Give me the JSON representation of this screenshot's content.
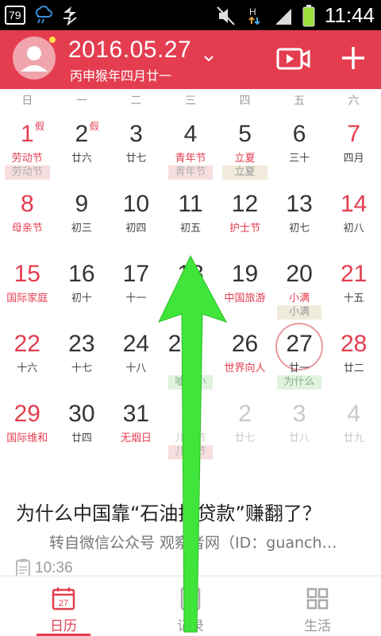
{
  "status_bar": {
    "badge": "79",
    "time": "11:44",
    "icons": [
      "cloud-rain-icon",
      "sync-icon",
      "mute-icon",
      "data-icon",
      "signal-icon",
      "battery-icon"
    ]
  },
  "header": {
    "date": "2016.05.27",
    "lunar": "丙申猴年四月廿一",
    "icons": [
      "avatar-icon",
      "chevron-down-icon",
      "video-icon",
      "plus-icon"
    ],
    "color": "#e43d50"
  },
  "weekdays": [
    "日",
    "一",
    "二",
    "三",
    "四",
    "五",
    "六"
  ],
  "weeks": [
    [
      {
        "day": "1",
        "sub": "劳动节",
        "tag": "劳动节",
        "badge": "假"
      },
      {
        "day": "2",
        "sub": "廿六",
        "badge": "假"
      },
      {
        "day": "3",
        "sub": "廿七"
      },
      {
        "day": "4",
        "sub": "青年节",
        "tag": "青年节"
      },
      {
        "day": "5",
        "sub": "立夏",
        "tag": "立夏"
      },
      {
        "day": "6",
        "sub": "三十"
      },
      {
        "day": "7",
        "sub": "四月"
      }
    ],
    [
      {
        "day": "8",
        "sub": "母亲节"
      },
      {
        "day": "9",
        "sub": "初三"
      },
      {
        "day": "10",
        "sub": "初四"
      },
      {
        "day": "11",
        "sub": "初五"
      },
      {
        "day": "12",
        "sub": "护士节"
      },
      {
        "day": "13",
        "sub": "初七"
      },
      {
        "day": "14",
        "sub": "初八"
      }
    ],
    [
      {
        "day": "15",
        "sub": "国际家庭"
      },
      {
        "day": "16",
        "sub": "初十"
      },
      {
        "day": "17",
        "sub": "十一"
      },
      {
        "day": "18",
        "sub": ""
      },
      {
        "day": "19",
        "sub": "中国旅游"
      },
      {
        "day": "20",
        "sub": "小满",
        "tag": "小满"
      },
      {
        "day": "21",
        "sub": "十五"
      }
    ],
    [
      {
        "day": "22",
        "sub": "十六"
      },
      {
        "day": "23",
        "sub": "十七"
      },
      {
        "day": "24",
        "sub": "十八"
      },
      {
        "day": "2",
        "sub": "",
        "tag": "嘘…小"
      },
      {
        "day": "26",
        "sub": "世界向人"
      },
      {
        "day": "27",
        "sub": "廿一",
        "tag": "为什么",
        "today": true
      },
      {
        "day": "28",
        "sub": "廿二"
      }
    ],
    [
      {
        "day": "29",
        "sub": "国际维和"
      },
      {
        "day": "30",
        "sub": "廿四"
      },
      {
        "day": "31",
        "sub": "无烟日"
      },
      {
        "day": "",
        "sub": "儿…节",
        "tag": "儿…节"
      },
      {
        "day": "2",
        "sub": "廿七"
      },
      {
        "day": "3",
        "sub": "廿八"
      },
      {
        "day": "4",
        "sub": "廿九"
      }
    ]
  ],
  "article": {
    "title": "为什么中国靠“石油换贷款”赚翻了？",
    "source": "转自微信公众号 观察者网（ID：guanch…",
    "time": "10:36"
  },
  "nav": [
    {
      "label": "日历",
      "icon": "calendar-icon",
      "icon_text": "27",
      "active": true
    },
    {
      "label": "记录",
      "icon": "notes-icon",
      "active": false
    },
    {
      "label": "生活",
      "icon": "grid-icon",
      "active": false
    }
  ],
  "overlay": {
    "icon": "green-up-arrow-icon",
    "color": "#3fe53a"
  }
}
